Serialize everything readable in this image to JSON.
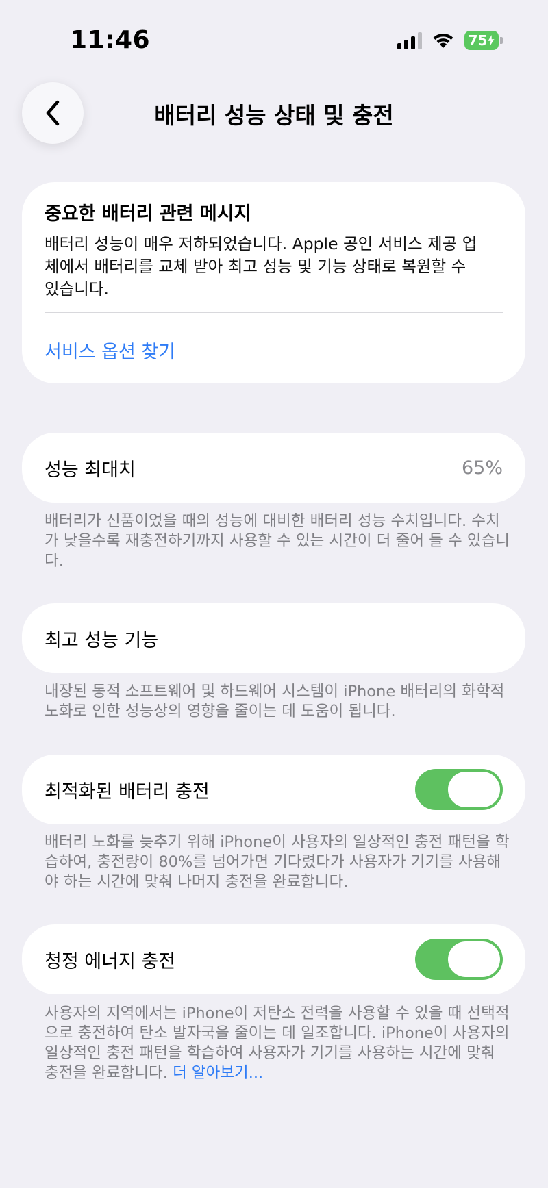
{
  "status_bar": {
    "time": "11:46",
    "battery_level": "75",
    "signal_bars_active": 3,
    "signal_bars_total": 4,
    "battery_color": "#5ac85e",
    "icons": [
      "cellular-signal-icon",
      "wifi-icon",
      "battery-charging-icon"
    ]
  },
  "nav": {
    "back_icon": "chevron-left-icon",
    "title": "배터리 성능 상태 및 충전"
  },
  "important_message": {
    "title": "중요한 배터리 관련 메시지",
    "body": "배터리 성능이 매우 저하되었습니다. Apple 공인 서비스 제공 업체에서 배터리를 교체 받아 최고 성능 및 기능 상태로 복원할 수 있습니다.",
    "link": "서비스 옵션 찾기"
  },
  "max_capacity": {
    "label": "성능 최대치",
    "value": "65%",
    "footnote": "배터리가 신품이었을 때의 성능에 대비한 배터리 성능 수치입니다. 수치가 낮을수록 재충전하기까지 사용할 수 있는 시간이 더 줄어 들 수 있습니다."
  },
  "peak_performance": {
    "label": "최고 성능 기능",
    "footnote": "내장된 동적 소프트웨어 및 하드웨어 시스템이 iPhone 배터리의 화학적 노화로 인한 성능상의 영향을 줄이는 데 도움이 됩니다."
  },
  "optimized_charging": {
    "label": "최적화된 배터리 충전",
    "enabled": true,
    "footnote": "배터리 노화를 늦추기 위해 iPhone이 사용자의 일상적인 충전 패턴을 학습하여, 충전량이 80%를 넘어가면 기다렸다가 사용자가 기기를 사용해야 하는 시간에 맞춰 나머지 충전을 완료합니다."
  },
  "clean_energy": {
    "label": "청정 에너지 충전",
    "enabled": true,
    "footnote": "사용자의 지역에서는 iPhone이 저탄소 전력을 사용할 수 있을 때 선택적으로 충전하여 탄소 발자국을 줄이는 데 일조합니다. iPhone이 사용자의 일상적인 충전 패턴을 학습하여 사용자가 기기를 사용하는 시간에 맞춰 충전을 완료합니다.",
    "link": "더 알아보기..."
  },
  "colors": {
    "accent_link": "#2f7cf6",
    "toggle_on": "#5ec160",
    "background": "#f0eff5"
  }
}
